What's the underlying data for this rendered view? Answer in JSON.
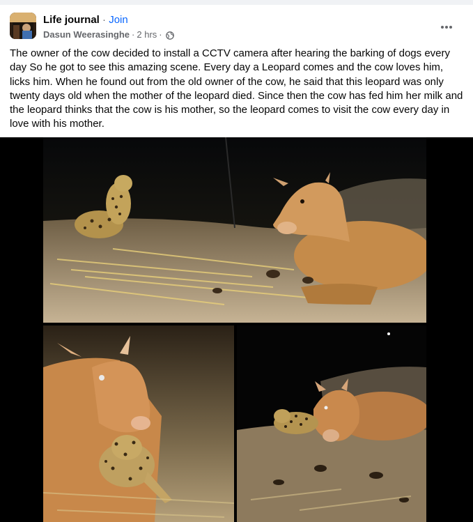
{
  "post": {
    "group_name": "Life journal",
    "separator": "·",
    "join_label": "Join",
    "author": "Dasun Weerasinghe",
    "time": "2 hrs",
    "privacy_icon": "globe-icon",
    "more_icon": "more-options-icon",
    "text": "The owner of the cow decided to install a CCTV camera after hearing the barking of dogs every day So he got to see this amazing scene. Every day a Leopard comes and the cow loves him, licks him. When he found out from the old owner of the cow, he said that this leopard was only twenty days old when the mother of the leopard died. Since then the cow has fed him her milk and the leopard thinks that the cow is his mother, so the leopard comes to visit the cow every day in love with his mother."
  },
  "colors": {
    "link_blue": "#0866ff",
    "secondary_text": "#65676b",
    "media_background": "#000000"
  }
}
